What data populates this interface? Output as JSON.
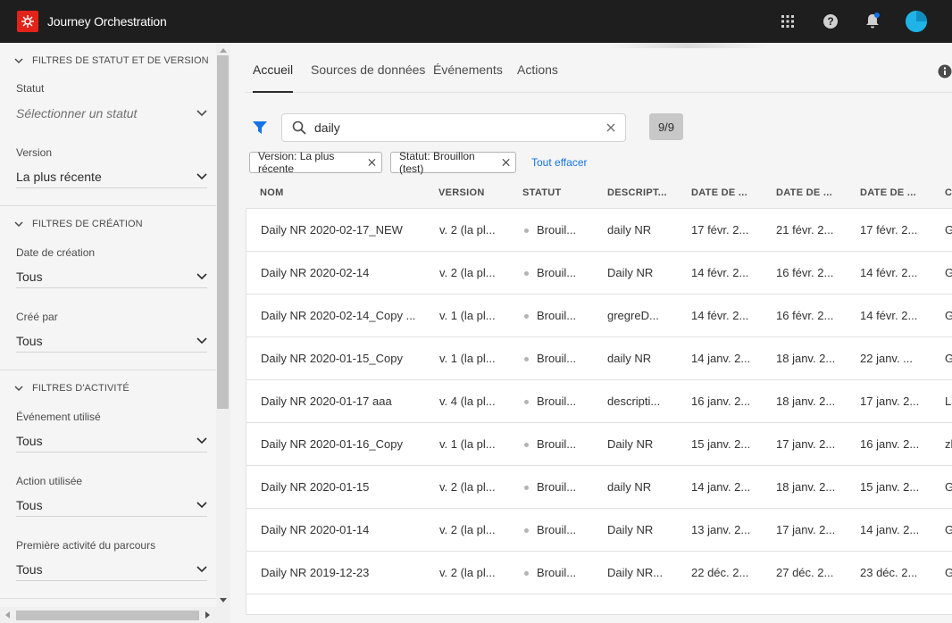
{
  "header": {
    "app_title": "Journey Orchestration",
    "icons": [
      "adobe-logo",
      "apps-grid-icon",
      "help-icon",
      "notifications-bell-icon",
      "user-avatar"
    ]
  },
  "sidebar": {
    "status_section": {
      "title": "FILTRES DE STATUT ET DE VERSION",
      "status_label": "Statut",
      "status_placeholder": "Sélectionner un statut",
      "version_label": "Version",
      "version_value": "La plus récente"
    },
    "creation_section": {
      "title": "FILTRES DE CRÉATION",
      "creation_date_label": "Date de création",
      "creation_date_value": "Tous",
      "created_by_label": "Créé par",
      "created_by_value": "Tous"
    },
    "activity_section": {
      "title": "FILTRES D'ACTIVITÉ",
      "event_label": "Événement utilisé",
      "event_value": "Tous",
      "action_label": "Action utilisée",
      "action_value": "Tous",
      "first_activity_label": "Première activité du parcours",
      "first_activity_value": "Tous"
    }
  },
  "tabs": [
    {
      "label": "Accueil",
      "active": true
    },
    {
      "label": "Sources de données",
      "active": false
    },
    {
      "label": "Événements",
      "active": false
    },
    {
      "label": "Actions",
      "active": false
    }
  ],
  "search": {
    "value": "daily",
    "count": "9/9"
  },
  "chips": {
    "version": "Version: La plus récente",
    "status": "Statut: Brouillon (test)",
    "clear_all": "Tout effacer"
  },
  "table": {
    "columns": [
      "NOM",
      "VERSION",
      "STATUT",
      "DESCRIPT...",
      "DATE DE ...",
      "DATE DE ...",
      "DATE DE ...",
      "CI"
    ],
    "rows": [
      {
        "name": "Daily NR 2020-02-17_NEW",
        "version": "v. 2 (la pl...",
        "status": "Brouil...",
        "description": "daily NR",
        "date1": "17 févr. 2...",
        "date2": "21 févr. 2...",
        "date3": "17 févr. 2...",
        "extra": "G"
      },
      {
        "name": "Daily NR 2020-02-14",
        "version": "v. 2 (la pl...",
        "status": "Brouil...",
        "description": "Daily NR",
        "date1": "14 févr. 2...",
        "date2": "16 févr. 2...",
        "date3": "14 févr. 2...",
        "extra": "G"
      },
      {
        "name": "Daily NR 2020-02-14_Copy ...",
        "version": "v. 1 (la pl...",
        "status": "Brouil...",
        "description": "gregreD...",
        "date1": "14 févr. 2...",
        "date2": "16 févr. 2...",
        "date3": "14 févr. 2...",
        "extra": "G"
      },
      {
        "name": "Daily NR 2020-01-15_Copy",
        "version": "v. 1 (la pl...",
        "status": "Brouil...",
        "description": "daily NR",
        "date1": "14 janv. 2...",
        "date2": "18 janv. 2...",
        "date3": "22 janv. ...",
        "extra": "G"
      },
      {
        "name": "Daily NR 2020-01-17 aaa",
        "version": "v. 4 (la pl...",
        "status": "Brouil...",
        "description": "descripti...",
        "date1": "16 janv. 2...",
        "date2": "18 janv. 2...",
        "date3": "17 janv. 2...",
        "extra": "La"
      },
      {
        "name": "Daily NR 2020-01-16_Copy",
        "version": "v. 1 (la pl...",
        "status": "Brouil...",
        "description": "Daily NR",
        "date1": "15 janv. 2...",
        "date2": "17 janv. 2...",
        "date3": "16 janv. 2...",
        "extra": "zh"
      },
      {
        "name": "Daily NR 2020-01-15",
        "version": "v. 2 (la pl...",
        "status": "Brouil...",
        "description": "daily NR",
        "date1": "14 janv. 2...",
        "date2": "18 janv. 2...",
        "date3": "15 janv. 2...",
        "extra": "G"
      },
      {
        "name": "Daily NR 2020-01-14",
        "version": "v. 2 (la pl...",
        "status": "Brouil...",
        "description": "Daily NR",
        "date1": "13 janv. 2...",
        "date2": "17 janv. 2...",
        "date3": "14 janv. 2...",
        "extra": "G"
      },
      {
        "name": "Daily NR 2019-12-23",
        "version": "v. 2 (la pl...",
        "status": "Brouil...",
        "description": "Daily NR...",
        "date1": "22 déc. 2...",
        "date2": "27 déc. 2...",
        "date3": "23 déc. 2...",
        "extra": "G"
      }
    ]
  },
  "colors": {
    "topbar": "#1e1e1e",
    "accent_blue": "#1473e6",
    "brand_red": "#e2231a",
    "avatar": "#1fb3e8"
  }
}
